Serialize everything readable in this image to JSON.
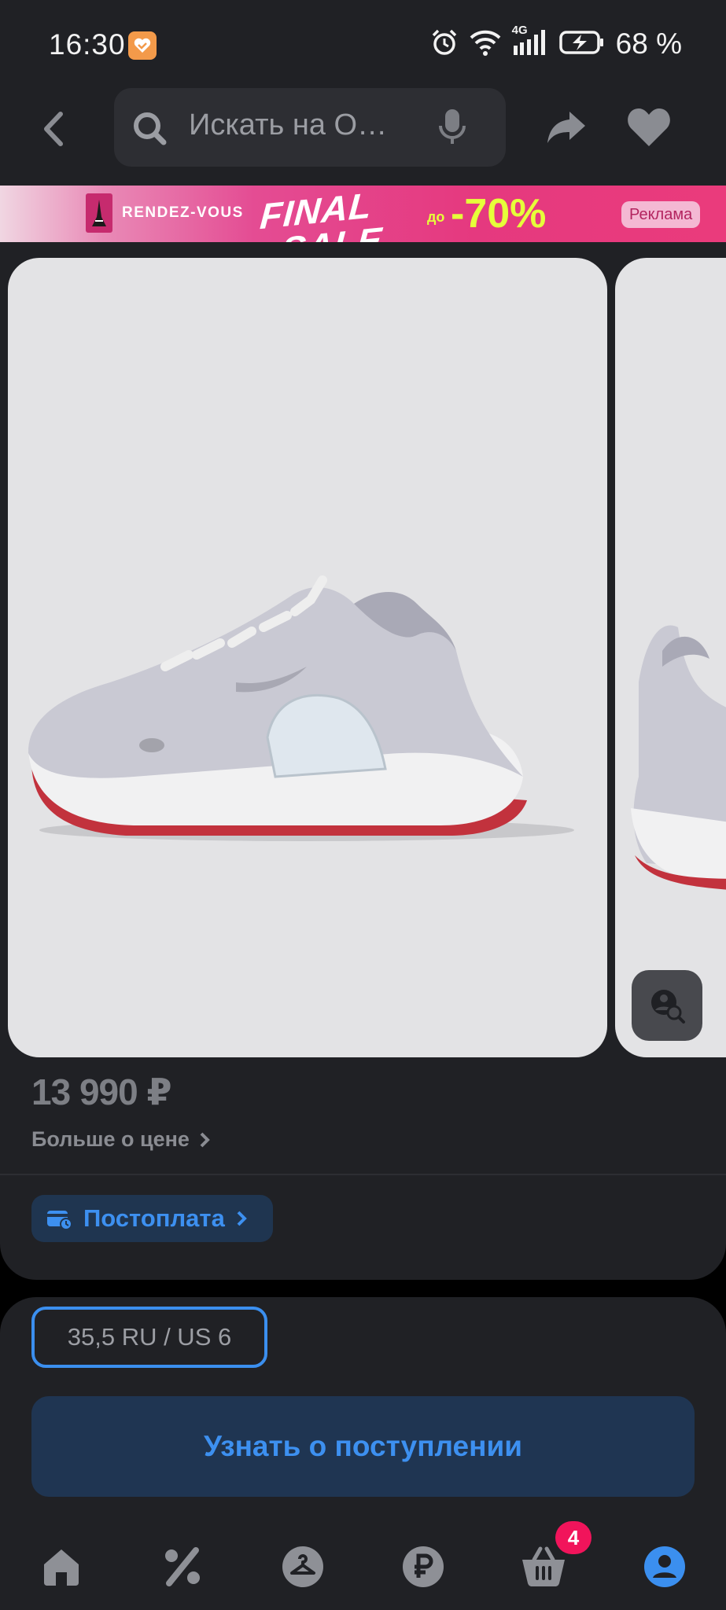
{
  "status_bar": {
    "time": "16:30",
    "network": "4G",
    "battery": "68 %",
    "icons": [
      "app-notification-icon",
      "alarm-icon",
      "wifi-icon",
      "signal-icon",
      "battery-charging-icon"
    ]
  },
  "header": {
    "search_placeholder": "Искать на O…",
    "icons": [
      "back-arrow-icon",
      "search-icon",
      "microphone-icon",
      "share-icon",
      "heart-icon"
    ]
  },
  "ad_banner": {
    "brand": "RENDEZ-VOUS",
    "headline_line1": "FINAL",
    "headline_line2": "SALE",
    "discount_prefix": "до",
    "discount": "-70%",
    "ad_label": "Реклама"
  },
  "product": {
    "price": "13 990 ₽",
    "price_more": "Больше о цене",
    "postpay_label": "Постоплата",
    "gallery_images": [
      "sneaker-side-view",
      "sneaker-heel-view"
    ]
  },
  "purchase": {
    "selected_size": "35,5 RU / US 6",
    "cta_label": "Узнать о поступлении"
  },
  "bottom_nav": {
    "items": [
      "home-icon",
      "discount-icon",
      "hanger-icon",
      "ruble-icon",
      "cart-icon",
      "profile-icon"
    ],
    "cart_badge": "4",
    "active_item": "profile-icon",
    "active_color": "#3b8fef",
    "inactive_color": "#8e9096"
  }
}
